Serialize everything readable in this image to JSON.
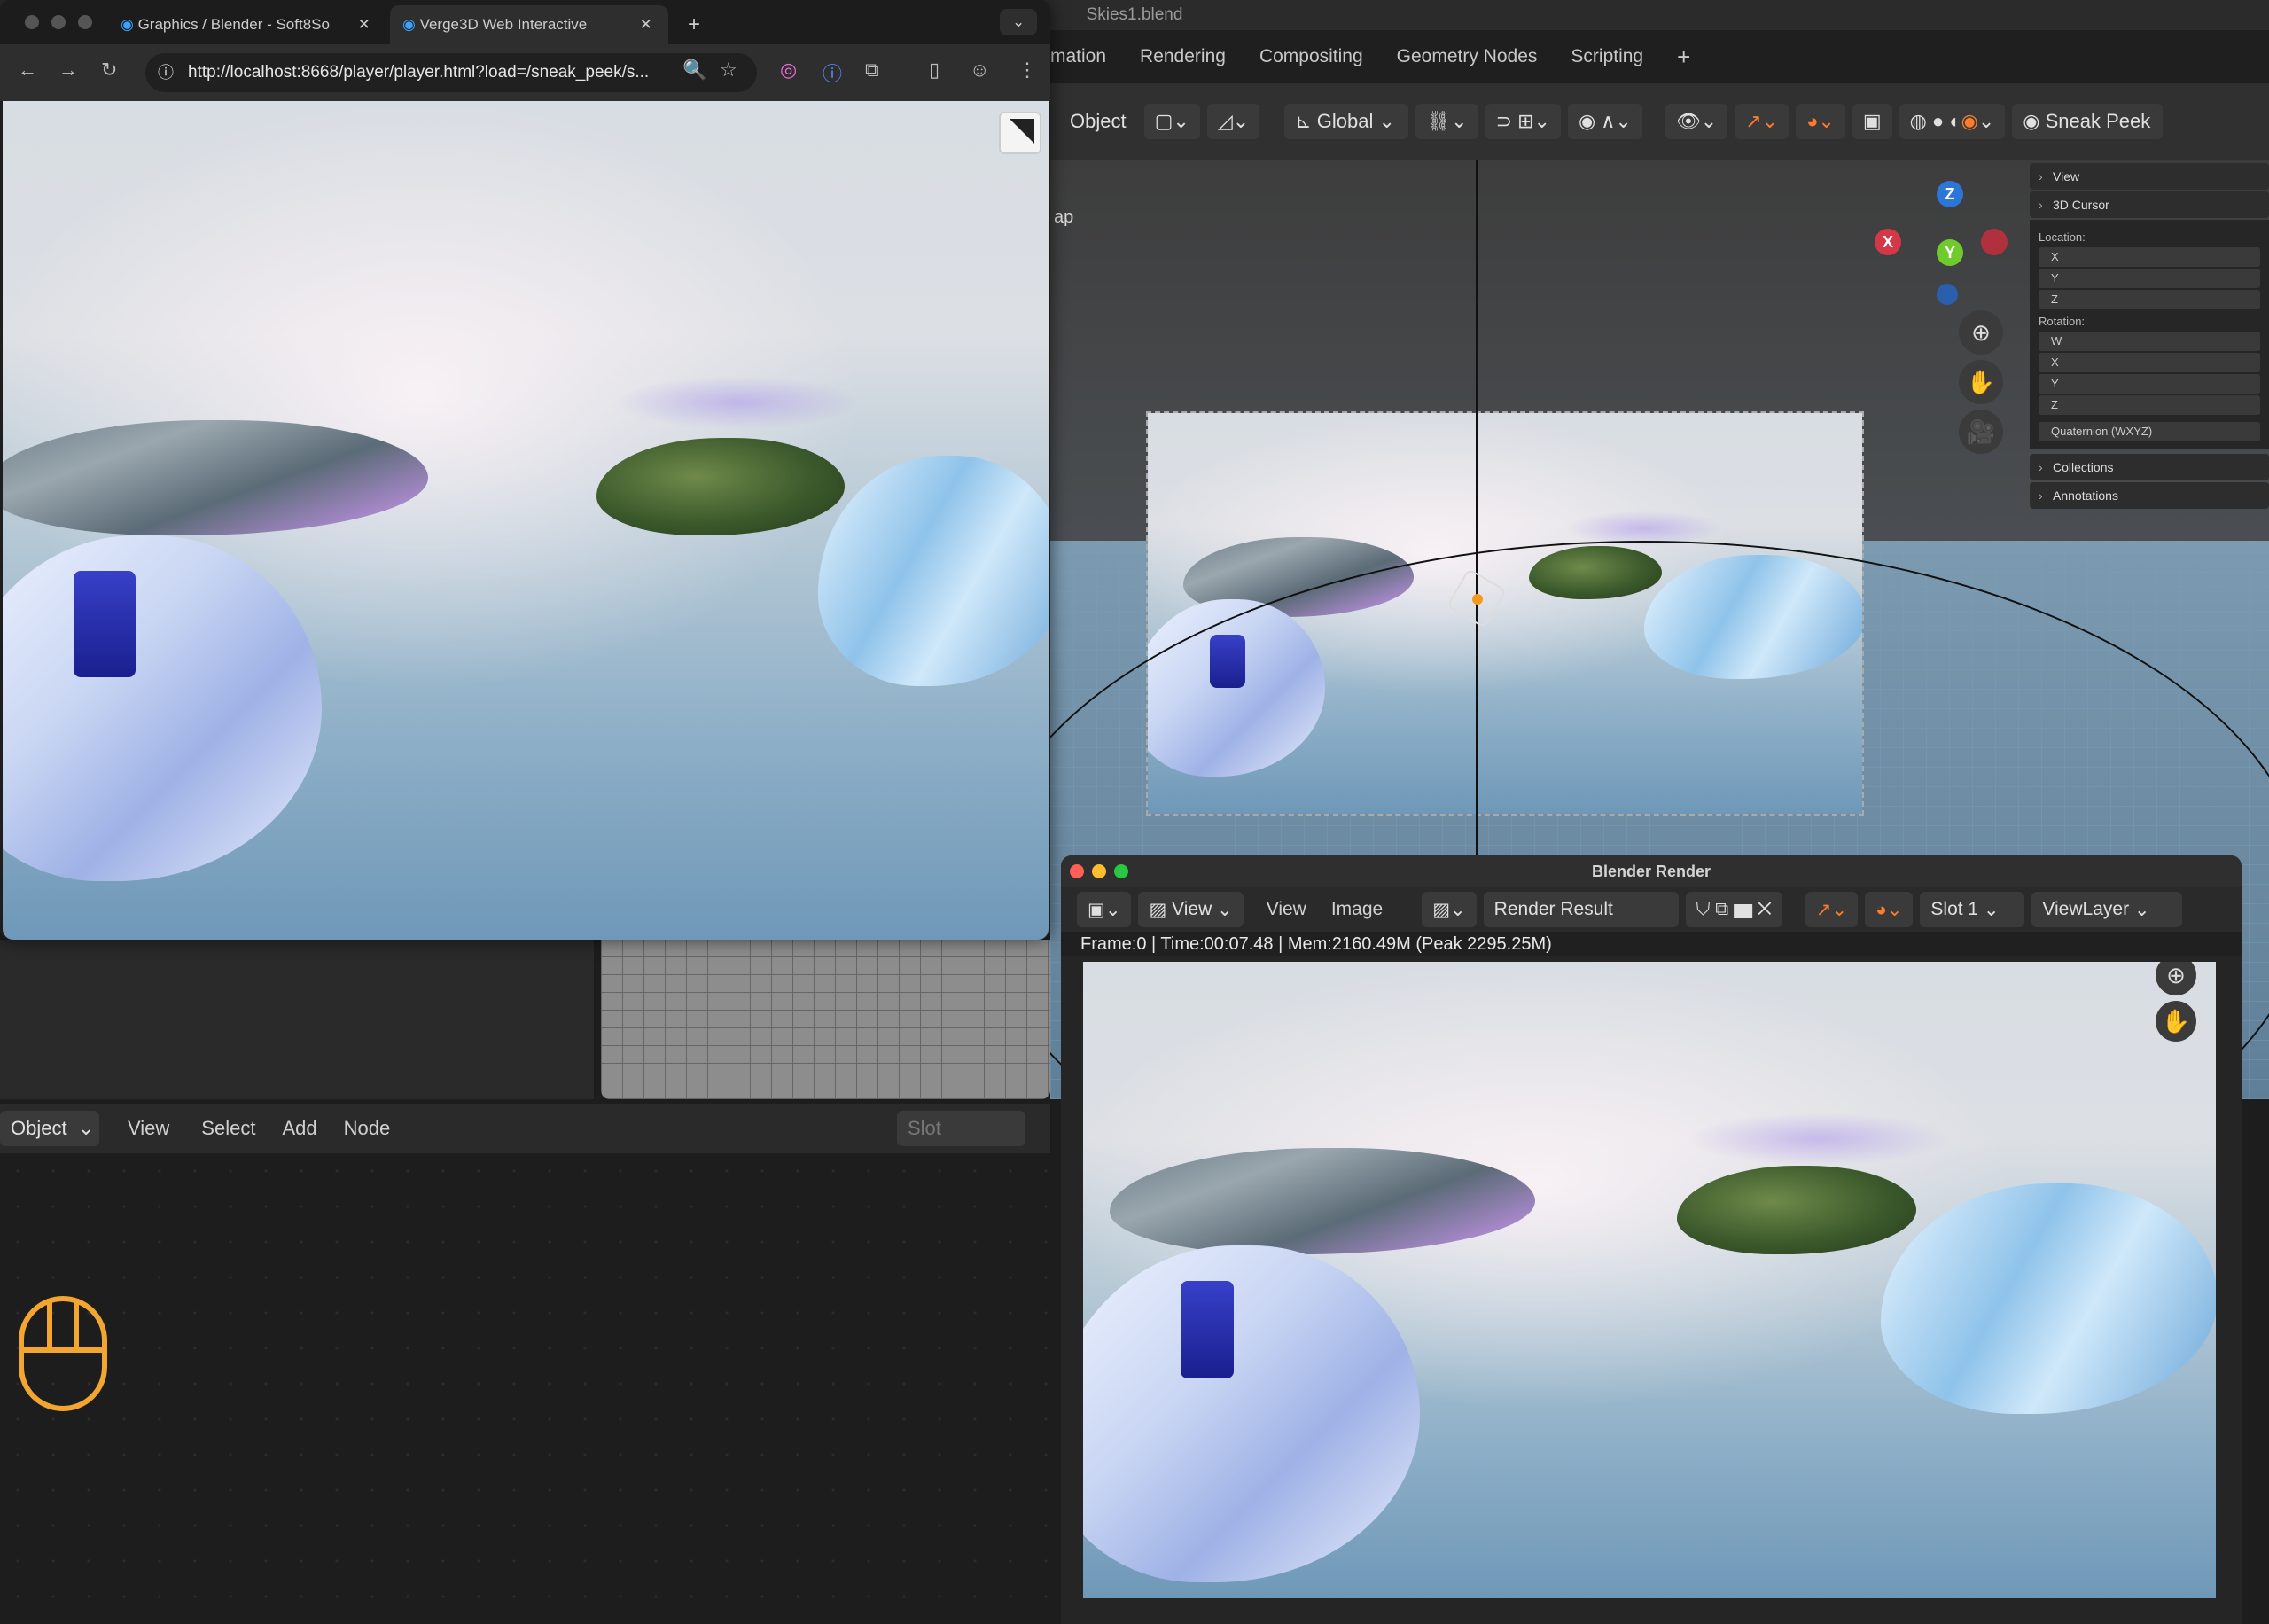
{
  "blender": {
    "file_title": "Skies1.blend",
    "workspace_tabs": [
      "mation",
      "Rendering",
      "Compositing",
      "Geometry Nodes",
      "Scripting",
      "+"
    ],
    "header": {
      "mode": "Object",
      "transform_orientation": "Global",
      "sneak_peek": "Sneak Peek"
    },
    "viewport_label": "ap",
    "gizmo": {
      "x": "X",
      "y": "Y",
      "z": "Z"
    },
    "npanel": {
      "view": "View",
      "cursor": "3D Cursor",
      "location": "Location:",
      "loc_fields": [
        "X",
        "Y",
        "Z"
      ],
      "rotation": "Rotation:",
      "rot_fields": [
        "W",
        "X",
        "Y",
        "Z"
      ],
      "rot_mode": "Quaternion (WXYZ)",
      "collections": "Collections",
      "annotations": "Annotations"
    },
    "shader_editor": {
      "mode": "Object",
      "menus": [
        "View",
        "Select",
        "Add",
        "Node"
      ],
      "slot": "Slot"
    }
  },
  "browser": {
    "tabs": [
      {
        "title": "Graphics / Blender - Soft8So"
      },
      {
        "title": "Verge3D Web Interactive"
      }
    ],
    "url": "http://localhost:8668/player/player.html?load=/sneak_peek/s..."
  },
  "render_window": {
    "title": "Blender Render",
    "view_label": "View",
    "menu_view": "View",
    "menu_image": "Image",
    "image_name": "Render Result",
    "slot": "Slot 1",
    "view_layer": "ViewLayer",
    "status": "Frame:0 | Time:00:07.48 | Mem:2160.49M (Peak 2295.25M)"
  },
  "colors": {
    "accent": "#ff7b2e",
    "blender_bg": "#1d1d1d",
    "mouse_icon": "#f2a531"
  }
}
